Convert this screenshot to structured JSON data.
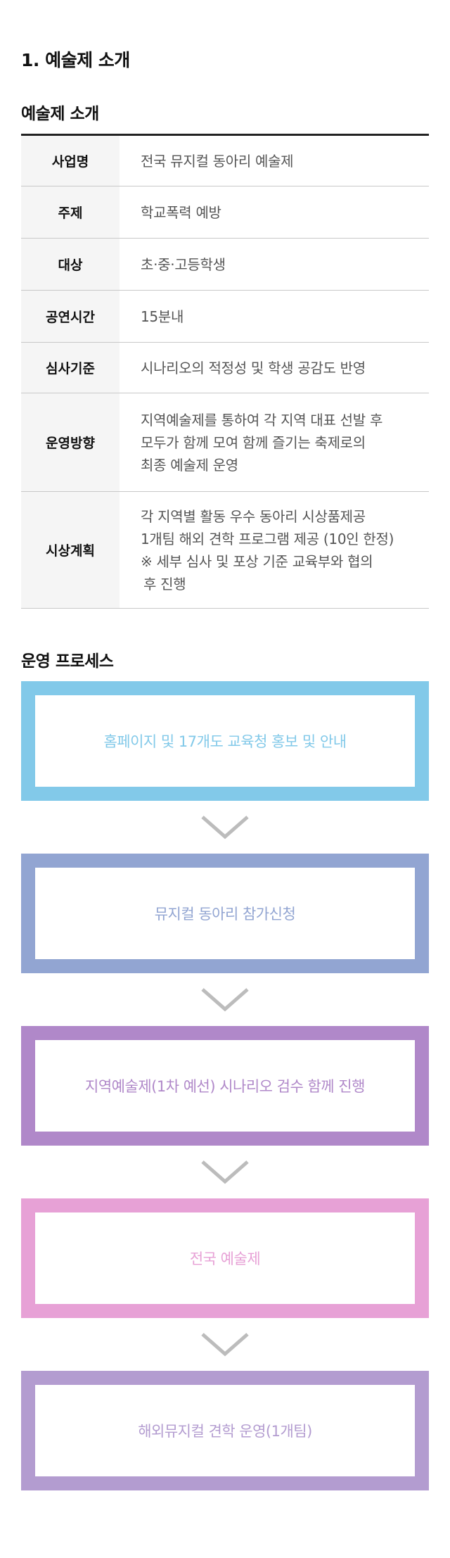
{
  "page_title": "1. 예술제 소개",
  "intro": {
    "title": "예술제 소개",
    "rows": [
      {
        "label": "사업명",
        "lines": [
          "전국 뮤지컬 동아리 예술제"
        ]
      },
      {
        "label": "주제",
        "lines": [
          "학교폭력 예방"
        ]
      },
      {
        "label": "대상",
        "lines": [
          "초·중·고등학생"
        ]
      },
      {
        "label": "공연시간",
        "lines": [
          "15분내"
        ]
      },
      {
        "label": "심사기준",
        "lines": [
          "시나리오의 적정성 및 학생 공감도 반영"
        ]
      },
      {
        "label": "운영방향",
        "lines": [
          "지역예술제를 통하여 각 지역 대표 선발 후",
          "모두가 함께 모여 함께 즐기는 축제로의",
          "최종 예술제 운영"
        ]
      },
      {
        "label": "시상계획",
        "lines": [
          "각 지역별 활동 우수 동아리 시상품제공",
          "1개팀 해외 견학 프로그램 제공 (10인 한정)",
          "※ 세부 심사 및 포상 기준 교육부와 협의",
          "후 진행"
        ]
      }
    ]
  },
  "process": {
    "title": "운영 프로세스",
    "steps": [
      {
        "text": "홈페이지 및 17개도 교육청 홍보 및 안내",
        "color": "#82c9e9"
      },
      {
        "text": "뮤지컬 동아리 참가신청",
        "color": "#92a5d2"
      },
      {
        "text": "지역예술제(1차 예선) 시나리오 검수 함께 진행",
        "color": "#b088c9"
      },
      {
        "text": "전국 예술제",
        "color": "#e7a1d6"
      },
      {
        "text": "해외뮤지컬 견학 운영(1개팀)",
        "color": "#b39cd0"
      }
    ],
    "arrow_color": "#bcbcbc"
  }
}
